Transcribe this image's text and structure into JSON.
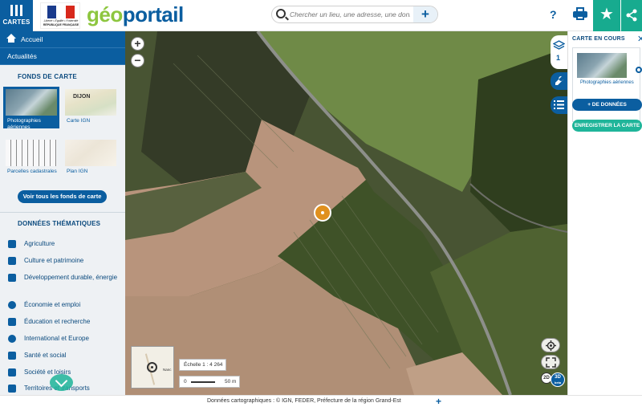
{
  "header": {
    "menu_label": "CARTES",
    "logo_motto": "Liberté • Égalité • Fraternité",
    "logo_republic": "RÉPUBLIQUE FRANÇAISE",
    "brand_geo": "géo",
    "brand_portail": "portail",
    "search_placeholder": "Chercher un lieu, une adresse, une donnée",
    "search_plus": "+",
    "help": "?",
    "favorite_icon": "star-icon",
    "share_icon": "share-icon",
    "accent_color": "#0b5ea0",
    "teal_color": "#17ab8f"
  },
  "sidebar": {
    "nav": [
      {
        "label": "Accueil",
        "icon": "home-icon"
      },
      {
        "label": "Actualités"
      }
    ],
    "basemaps_title": "FONDS DE CARTE",
    "basemaps": [
      {
        "label": "Photographies aériennes",
        "selected": true
      },
      {
        "label": "Carte IGN",
        "map_text": "DIJON"
      },
      {
        "label": "Parcelles cadastrales"
      },
      {
        "label": "Plan IGN"
      }
    ],
    "see_all": "Voir tous les fonds de carte",
    "themes_title": "DONNÉES THÉMATIQUES",
    "themes": [
      {
        "label": "Agriculture",
        "icon": "sprout-icon"
      },
      {
        "label": "Culture et patrimoine",
        "icon": "museum-icon"
      },
      {
        "label": "Développement durable, énergie",
        "icon": "leaf-icon"
      },
      {
        "label": "Économie et emploi",
        "icon": "pie-chart-icon"
      },
      {
        "label": "Éducation et recherche",
        "icon": "book-icon"
      },
      {
        "label": "International et Europe",
        "icon": "globe-icon"
      },
      {
        "label": "Santé et social",
        "icon": "medkit-icon"
      },
      {
        "label": "Société et loisirs",
        "icon": "people-icon"
      },
      {
        "label": "Territoires et transports",
        "icon": "road-icon"
      }
    ]
  },
  "map": {
    "zoom_in": "+",
    "zoom_out": "−",
    "scale_label": "Échelle 1 : 4 264",
    "scale_zero": "0",
    "scale_end": "50 m",
    "minimap_place": "Nanc",
    "layer_count": "1",
    "label_2d": "2D",
    "label_3d": "3D",
    "label_3d_sub": "beta"
  },
  "right_panel": {
    "title": "CARTE EN COURS",
    "layer_caption": "Photographies aériennes",
    "add_data": "+ DE DONNÉES",
    "save_map": "ENREGISTRER LA CARTE"
  },
  "footer": {
    "attribution": "Données cartographiques : ©  IGN,  FEDER,  Préfecture de la région Grand-Est",
    "plus": "+"
  }
}
